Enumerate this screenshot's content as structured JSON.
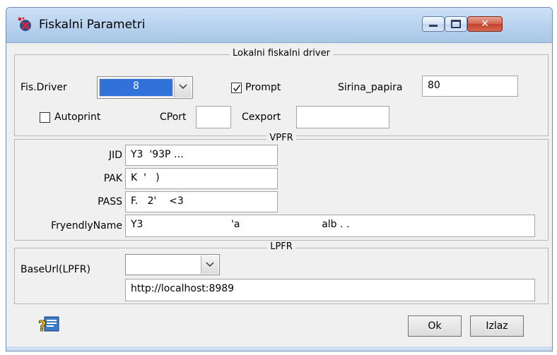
{
  "window": {
    "title": "Fiskalni Parametri",
    "controls": {
      "minimize": "minimize",
      "maximize": "maximize",
      "close": "✕"
    }
  },
  "lokalni": {
    "group_title": "Lokalni fiskalni driver",
    "fis_driver_label": "Fis.Driver",
    "fis_driver_value": "8",
    "prompt_label": "Prompt",
    "prompt_checked": true,
    "sirina_label": "Sirina_papira",
    "sirina_value": "80",
    "autoprint_label": "Autoprint",
    "autoprint_checked": false,
    "cport_label": "CPort",
    "cport_value": "",
    "cexport_label": "Cexport",
    "cexport_value": ""
  },
  "vpfr": {
    "group_title": "VPFR",
    "jid_label": "JID",
    "jid_value": "Y3  '93P …",
    "pak_label": "PAK",
    "pak_value": "K  '   )",
    "pass_label": "PASS",
    "pass_value": "F.   2'    <3",
    "friendly_label": "FryendlyName",
    "friendly_value": "Y3                            'a                          alb . ."
  },
  "lpfr": {
    "group_title": "LPFR",
    "base_url_label": "BaseUrl(LPFR)",
    "base_url_selected": "",
    "base_url_value": "http://localhost:8989"
  },
  "footer": {
    "help_icon": "help-icon",
    "ok_label": "Ok",
    "izlaz_label": "Izlaz"
  },
  "colors": {
    "selection": "#3072d9",
    "titlebar": "#b9d3ef",
    "close_button": "#c2412a"
  }
}
